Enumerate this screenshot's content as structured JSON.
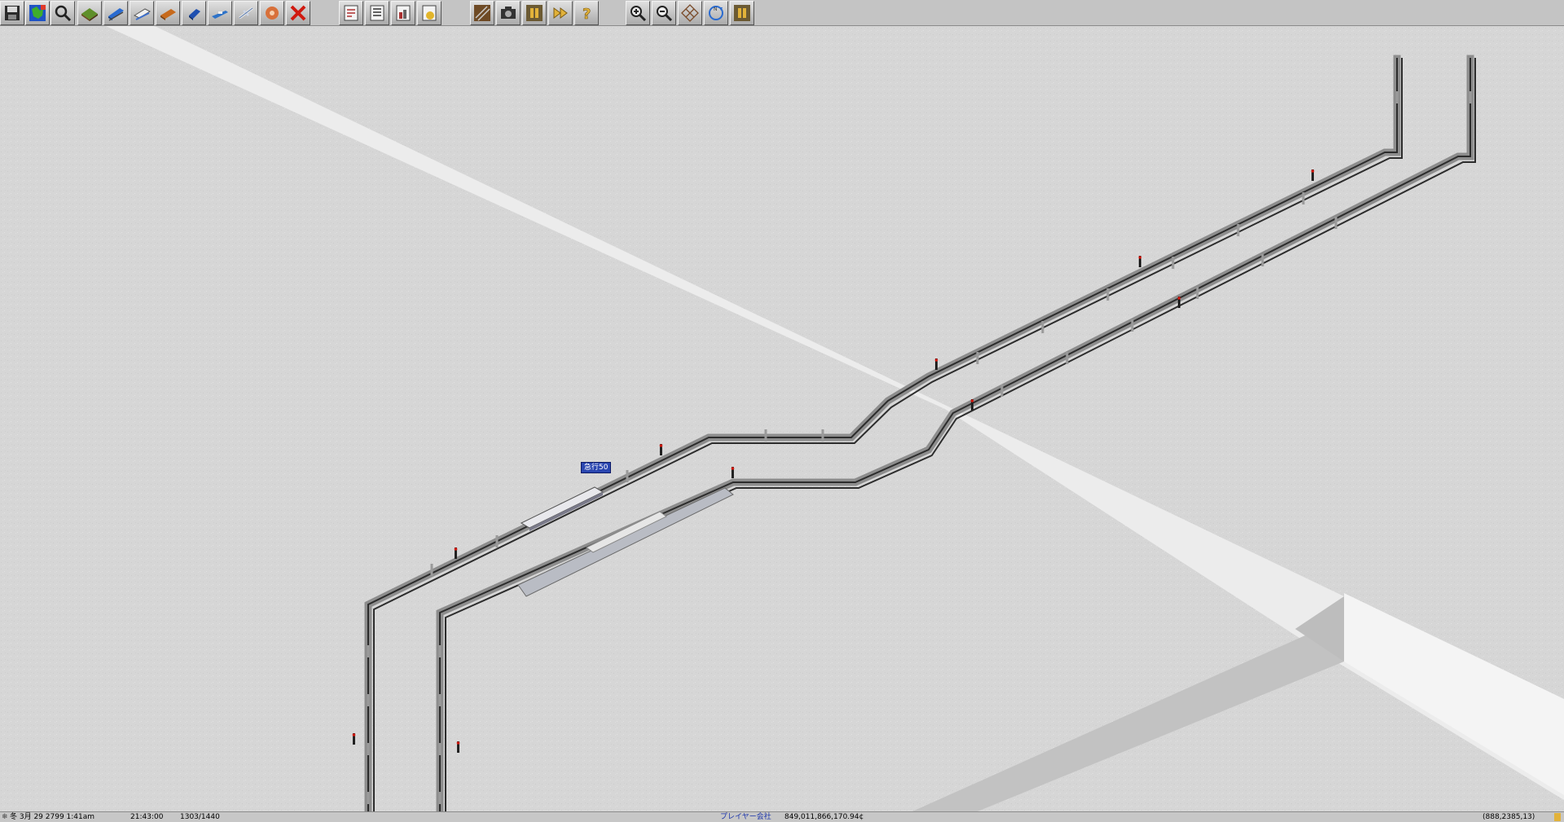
{
  "toolbar": {
    "tools": [
      {
        "icon": "save-disk-icon",
        "name": "save-button"
      },
      {
        "icon": "world-map-icon",
        "name": "minimap-button"
      },
      {
        "icon": "magnifier-icon",
        "name": "inspect-button"
      },
      {
        "icon": "terrain-slope-icon",
        "name": "landscape-tools-button"
      },
      {
        "icon": "railway-train-icon",
        "name": "rail-tools-button"
      },
      {
        "icon": "monorail-icon",
        "name": "monorail-tools-button"
      },
      {
        "icon": "tram-icon",
        "name": "tram-tools-button"
      },
      {
        "icon": "road-vehicle-icon",
        "name": "road-tools-button"
      },
      {
        "icon": "ship-icon",
        "name": "ship-tools-button"
      },
      {
        "icon": "airplane-icon",
        "name": "air-tools-button"
      },
      {
        "icon": "special-construction-icon",
        "name": "special-tools-button"
      },
      {
        "icon": "remove-x-icon",
        "name": "remove-button"
      },
      {
        "icon": "line-management-icon",
        "name": "line-management-button"
      },
      {
        "icon": "convoy-list-icon",
        "name": "convoy-list-button"
      },
      {
        "icon": "city-list-icon",
        "name": "city-list-button"
      },
      {
        "icon": "finance-icon",
        "name": "finances-button"
      },
      {
        "icon": "rail-settings-icon",
        "name": "settings-button"
      },
      {
        "icon": "camera-icon",
        "name": "screenshot-button"
      },
      {
        "icon": "pause-icon",
        "name": "pause-button"
      },
      {
        "icon": "fast-forward-icon",
        "name": "fast-forward-button"
      },
      {
        "icon": "help-question-icon",
        "name": "help-button"
      },
      {
        "icon": "zoom-in-icon",
        "name": "zoom-in-button"
      },
      {
        "icon": "zoom-out-icon",
        "name": "zoom-out-button"
      },
      {
        "icon": "grid-icon",
        "name": "grid-toggle-button"
      },
      {
        "icon": "compass-rotate-icon",
        "name": "rotate-view-button"
      },
      {
        "icon": "pause-icon",
        "name": "pause-button-2"
      }
    ]
  },
  "world": {
    "convoy_label": "急行50"
  },
  "status": {
    "season_icon": "snowflake-icon",
    "date": "冬 3月 29 2799  1:41am",
    "elapsed": "21:43:00",
    "ticks": "1303/1440",
    "company": "プレイヤー会社",
    "money": "849,011,866,170.94¢",
    "coords": "(888,2385,13)"
  },
  "colors": {
    "toolbar": "#c4c4c4",
    "snow": "#d7d7d7",
    "snow_path": "#eeeeee",
    "status_company": "#1a33aa",
    "convoy_label_bg": "#2a46b0"
  }
}
